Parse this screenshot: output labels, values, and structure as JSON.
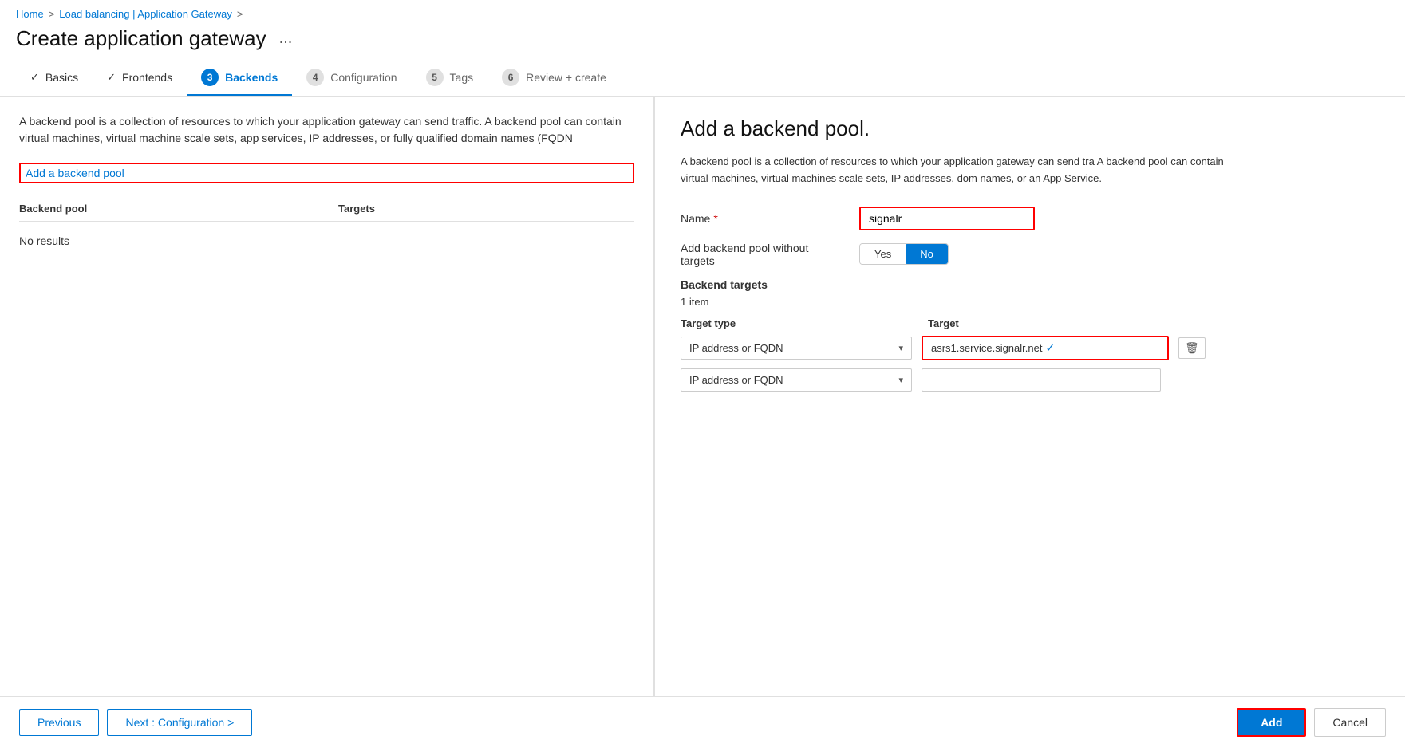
{
  "breadcrumb": {
    "home": "Home",
    "separator1": ">",
    "loadBalancing": "Load balancing | Application Gateway",
    "separator2": ">"
  },
  "pageHeader": {
    "title": "Create application gateway",
    "ellipsis": "..."
  },
  "wizardTabs": [
    {
      "id": "basics",
      "label": "Basics",
      "state": "completed",
      "stepNum": ""
    },
    {
      "id": "frontends",
      "label": "Frontends",
      "state": "completed",
      "stepNum": ""
    },
    {
      "id": "backends",
      "label": "Backends",
      "state": "active",
      "stepNum": "3"
    },
    {
      "id": "configuration",
      "label": "Configuration",
      "state": "inactive",
      "stepNum": "4"
    },
    {
      "id": "tags",
      "label": "Tags",
      "state": "inactive",
      "stepNum": "5"
    },
    {
      "id": "review",
      "label": "Review + create",
      "state": "inactive",
      "stepNum": "6"
    }
  ],
  "leftPanel": {
    "description": "A backend pool is a collection of resources to which your application gateway can send traffic. A backend pool can contain virtual machines, virtual machine scale sets, app services, IP addresses, or fully qualified domain names (FQDN",
    "addPoolLink": "Add a backend pool",
    "tableHeaders": {
      "pool": "Backend pool",
      "targets": "Targets"
    },
    "noResults": "No results"
  },
  "rightPanel": {
    "title": "Add a backend pool.",
    "description": "A backend pool is a collection of resources to which your application gateway can send tra A backend pool can contain virtual machines, virtual machines scale sets, IP addresses, dom names, or an App Service.",
    "nameLabel": "Name",
    "nameValue": "signalr",
    "toggleLabel": "Add backend pool without targets",
    "toggleOptions": [
      "Yes",
      "No"
    ],
    "toggleActive": "No",
    "backendTargetsLabel": "Backend targets",
    "itemCount": "1 item",
    "targetTypeHeader": "Target type",
    "targetHeader": "Target",
    "targetRows": [
      {
        "typeValue": "IP address or FQDN",
        "targetValue": "asrs1.service.signalr.net",
        "hasValue": true
      },
      {
        "typeValue": "IP address or FQDN",
        "targetValue": "",
        "hasValue": false
      }
    ]
  },
  "bottomBar": {
    "prevLabel": "Previous",
    "nextLabel": "Next : Configuration >",
    "addLabel": "Add",
    "cancelLabel": "Cancel"
  }
}
